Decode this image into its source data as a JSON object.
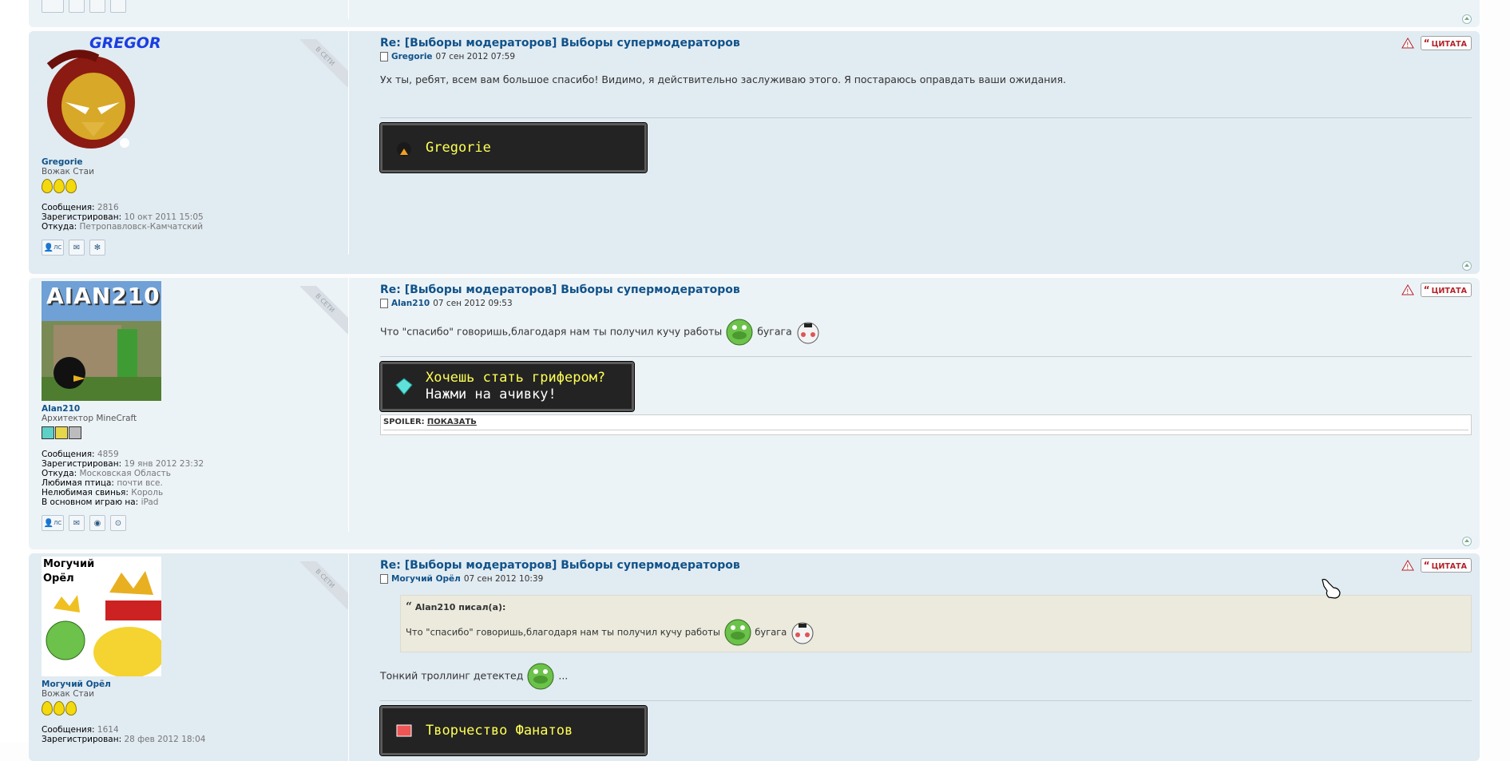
{
  "labels": {
    "online": "В СЕТИ",
    "quote": "ЦИТАТА",
    "messages": "Сообщения:",
    "registered": "Зарегистрирован:",
    "from": "Откуда:",
    "pm": "ЛС"
  },
  "posts": [
    {
      "avatar_text": "GREGORIE",
      "username": "Gregorie",
      "rank": "Вожак Стаи",
      "messages": "2816",
      "registered": "10 окт 2011 15:05",
      "from": "Петропавловск-Камчатский",
      "title": "Re: [Выборы модераторов] Выборы супермодераторов",
      "author": "Gregorie",
      "date": "07 сен 2012 07:59",
      "text": "Ух ты, ребят, всем вам большое спасибо! Видимо, я действительно заслуживаю этого. Я постараюсь оправдать ваши ожидания.",
      "badge_line1": "Gregorie"
    },
    {
      "avatar_text": "AIAN210",
      "username": "Alan210",
      "rank": "Архитектор MineCraft",
      "messages": "4859",
      "registered": "19 янв 2012 23:32",
      "from": "Московская Область",
      "fav_bird_label": "Любимая птица:",
      "fav_bird": "почти все.",
      "hated_pig_label": "Нелюбимая свинья:",
      "hated_pig": "Король",
      "play_on_label": "В основном играю на:",
      "play_on": "iPad",
      "title": "Re: [Выборы модераторов] Выборы супермодераторов",
      "author": "Alan210",
      "date": "07 сен 2012 09:53",
      "text_a": "Что \"спасибо\" говоришь,благодаря нам ты получил кучу работы",
      "text_b": "бугага",
      "badge_line1": "Хочешь стать грифером?",
      "badge_line2": "Нажми на ачивку!",
      "spoiler_label": "SPOILER:",
      "spoiler_show": "ПОКАЗАТЬ"
    },
    {
      "avatar_text1": "Могучий",
      "avatar_text2": "Орёл",
      "username": "Могучий Орёл",
      "rank": "Вожак Стаи",
      "messages": "1614",
      "registered": "28 фев 2012 18:04",
      "title": "Re: [Выборы модераторов] Выборы супермодераторов",
      "author": "Могучий Орёл",
      "date": "07 сен 2012 10:39",
      "quote_author": "Alan210 писал(а):",
      "quote_text_a": "Что \"спасибо\" говоришь,благодаря нам ты получил кучу работы",
      "quote_text_b": "бугага",
      "text_a": "Тонкий троллинг детектед",
      "text_b": "...",
      "badge_line1": "Творчество Фанатов"
    }
  ]
}
